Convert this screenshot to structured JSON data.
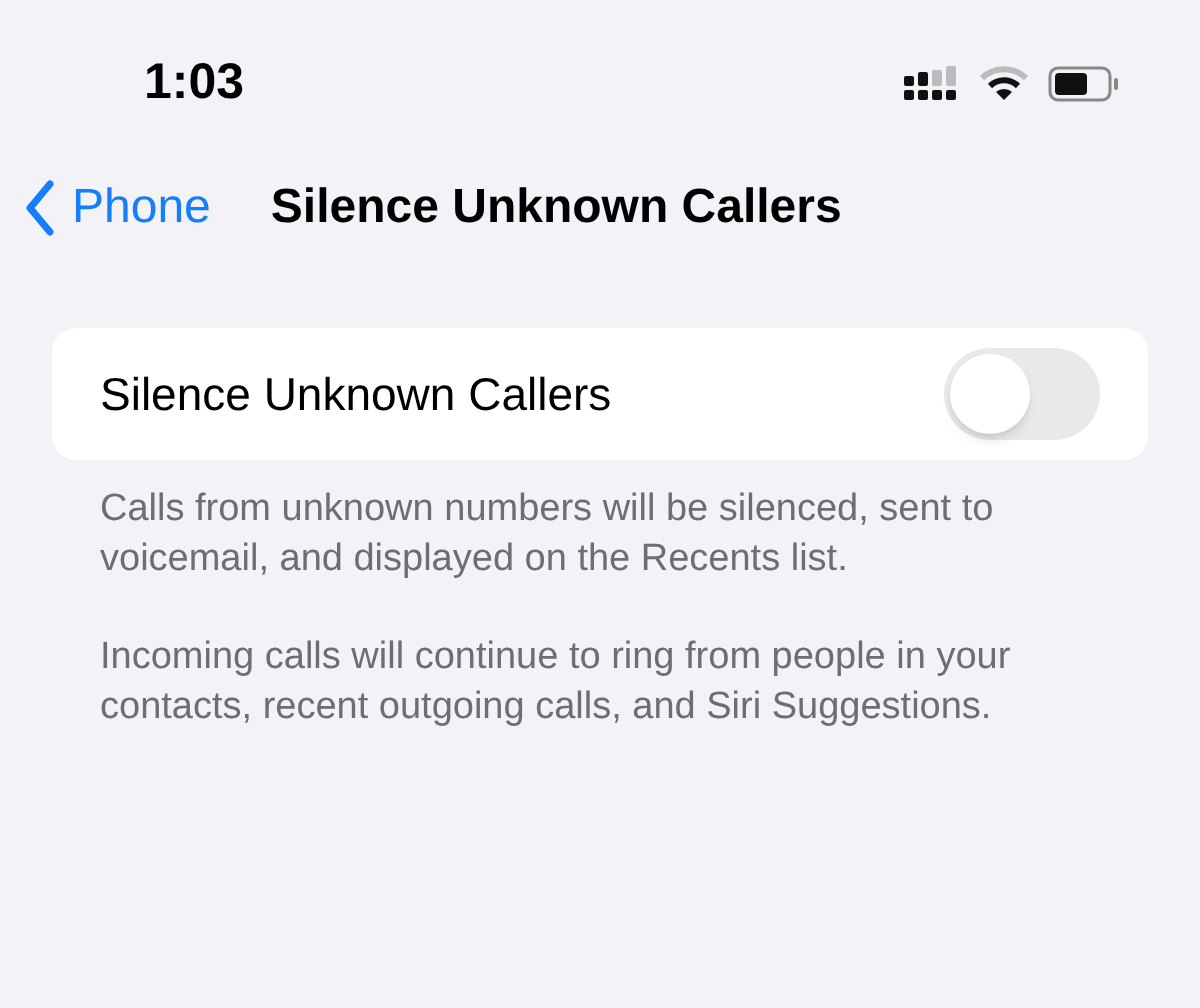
{
  "status_bar": {
    "time": "1:03"
  },
  "nav": {
    "back": "Phone",
    "title": "Silence Unknown Callers"
  },
  "setting": {
    "label": "Silence Unknown Callers",
    "on": false
  },
  "footnotes": [
    "Calls from unknown numbers will be silenced, sent to voicemail, and displayed on the Recents list.",
    "Incoming calls will continue to ring from people in your contacts, recent outgoing calls, and Siri Suggestions."
  ]
}
